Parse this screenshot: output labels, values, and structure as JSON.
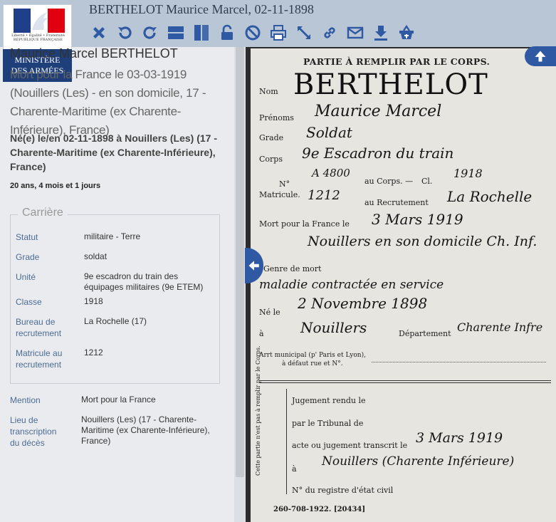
{
  "header": {
    "title": "BERTHELOT Maurice Marcel, 02-11-1898",
    "toolbar_icons": [
      "close-icon",
      "rotate-left-icon",
      "rotate-right-icon",
      "horizontal-layout-icon",
      "vertical-layout-icon",
      "lock-icon",
      "block-icon",
      "print-icon",
      "fullscreen-icon",
      "link-icon",
      "mail-icon",
      "download-icon",
      "basket-icon"
    ],
    "icon_color": "#2f5aa3"
  },
  "logo": {
    "motto": "Liberté • Égalité • Fraternité",
    "republic": "RÉPUBLIQUE FRANÇAISE",
    "ministry": [
      "MINISTÈRE",
      "DES ARMÉES"
    ]
  },
  "person": {
    "name": "Maurice Marcel BERTHELOT",
    "death": "Mort pour la France le 03-03-1919 (Nouillers (Les) - en son domicile, 17 - Charente-Maritime (ex Charente-Inférieure), France)",
    "birth": "Né(e) le/en 02-11-1898 à Nouillers (Les) (17 - Charente-Maritime (ex Charente-Inférieure), France)",
    "age": "20 ans, 4 mois et 1 jours"
  },
  "career": {
    "legend": "Carrière",
    "rows": [
      {
        "label": "Statut",
        "value": "militaire - Terre"
      },
      {
        "label": "Grade",
        "value": "soldat"
      },
      {
        "label": "Unité",
        "value": "9e escadron du train des équipages militaires (9e ETEM)"
      },
      {
        "label": "Classe",
        "value": "1918"
      },
      {
        "label": "Bureau de recrutement",
        "value": "La Rochelle (17)"
      },
      {
        "label": "Matricule au recrutement",
        "value": "1212"
      }
    ]
  },
  "extra": [
    {
      "label": "Mention",
      "value": "Mort pour la France"
    },
    {
      "label": "Lieu de transcription du décès",
      "value": "Nouillers (Les) (17 - Charente-Maritime (ex Charente-Inférieure), France)"
    }
  ],
  "document": {
    "header": "PARTIE À REMPLIR PAR LE CORPS.",
    "surname": "BERTHELOT",
    "labels": {
      "nom": "Nom",
      "prenoms": "Prénoms",
      "grade": "Grade",
      "corps": "Corps",
      "no": "N°",
      "matricule": "Matricule.",
      "au_corps": "au Corps. —",
      "cl": "Cl.",
      "au_recrutement": "au Recrutement",
      "mort_pour": "Mort pour la France le",
      "a": "à",
      "genre": "Genre de mort",
      "ne_le": "Né le",
      "departement": "Département",
      "arrt": "Arrt municipal (p' Paris et Lyon),",
      "defaut": "à défaut rue et N°.",
      "jugement": "Jugement rendu le",
      "tribunal": "par le Tribunal de",
      "acte": "acte ou jugement transcrit le",
      "registre": "N° du registre d'état civil",
      "side_note": "Cette partie n'est pas à remplir par le Corps.",
      "footer": "260-708-1922. [20434]"
    },
    "hand": {
      "prenoms": "Maurice Marcel",
      "grade": "Soldat",
      "corps": "9e Escadron du train",
      "corps_no": "A 4800",
      "classe": "1918",
      "matricule": "1212",
      "recrutement": "La Rochelle",
      "mort_date": "3 Mars 1919",
      "mort_lieu": "Nouillers en son domicile Ch. Inf.",
      "genre": "maladie contractée en service",
      "ne_date": "2 Novembre 1898",
      "ne_lieu": "Nouillers",
      "departement": "Charente Infre",
      "transcrit": "3 Mars 1919",
      "transcrit_lieu": "Nouillers (Charente Inférieure)"
    }
  },
  "nav": {
    "up_icon": "arrow-up-icon",
    "collapse_icon": "arrow-left-icon"
  }
}
